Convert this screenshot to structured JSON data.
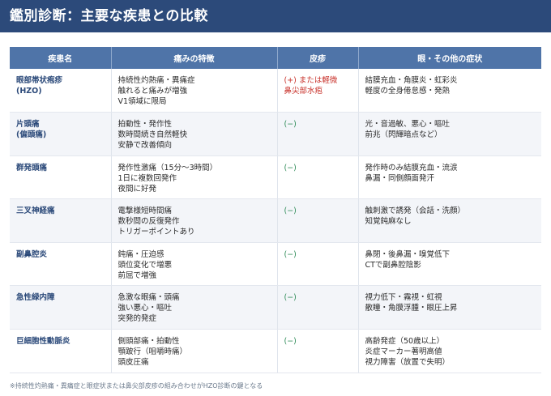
{
  "title": "鑑別診断：主要な疾患との比較",
  "columns": [
    "疾患名",
    "痛みの特徴",
    "皮疹",
    "眼・その他の症状"
  ],
  "rows": [
    {
      "disease": [
        "眼部帯状疱疹",
        "(HZO)"
      ],
      "pain": [
        "持続性灼熱痛・異痛症",
        "触れると痛みが増強",
        "V1領域に限局"
      ],
      "rash": [
        "(+) または軽微",
        "鼻尖部水疱"
      ],
      "rash_positive": true,
      "other": [
        "結膜充血・角膜炎・虹彩炎",
        "軽度の全身倦怠感・発熱"
      ]
    },
    {
      "disease": [
        "片頭痛",
        "(偏頭痛)"
      ],
      "pain": [
        "拍動性・発作性",
        "数時間続き自然軽快",
        "安静で改善傾向"
      ],
      "rash": [
        "(−)"
      ],
      "rash_positive": false,
      "other": [
        "光・音過敏、悪心・嘔吐",
        "前兆（閃輝暗点など）"
      ]
    },
    {
      "disease": [
        "群発頭痛"
      ],
      "pain": [
        "発作性激痛（15分〜3時間）",
        "1日に複数回発作",
        "夜間に好発"
      ],
      "rash": [
        "(−)"
      ],
      "rash_positive": false,
      "other": [
        "発作時のみ結膜充血・流涙",
        "鼻漏・同側顔面発汗"
      ]
    },
    {
      "disease": [
        "三叉神経痛"
      ],
      "pain": [
        "電撃様短時間痛",
        "数秒間の反復発作",
        "トリガーポイントあり"
      ],
      "rash": [
        "(−)"
      ],
      "rash_positive": false,
      "other": [
        "触刺激で誘発（会話・洗顔）",
        "知覚鈍麻なし"
      ]
    },
    {
      "disease": [
        "副鼻腔炎"
      ],
      "pain": [
        "鈍痛・圧迫感",
        "頭位変化で増悪",
        "前屈で増強"
      ],
      "rash": [
        "(−)"
      ],
      "rash_positive": false,
      "other": [
        "鼻閉・後鼻漏・嗅覚低下",
        "CTで副鼻腔陰影"
      ]
    },
    {
      "disease": [
        "急性緑内障"
      ],
      "pain": [
        "急激な眼痛・頭痛",
        "強い悪心・嘔吐",
        "突発的発症"
      ],
      "rash": [
        "(−)"
      ],
      "rash_positive": false,
      "other": [
        "視力低下・霧視・虹視",
        "散瞳・角膜浮腫・眼圧上昇"
      ]
    },
    {
      "disease": [
        "巨細胞性動脈炎"
      ],
      "pain": [
        "側頭部痛・拍動性",
        "顎跛行（咀嚼時痛）",
        "頭皮圧痛"
      ],
      "rash": [
        "(−)"
      ],
      "rash_positive": false,
      "other": [
        "高齢発症（50歳以上）",
        "炎症マーカー著明高値",
        "視力障害（放置で失明）"
      ]
    }
  ],
  "footnote": "※持続性灼熱痛・異痛症と眼症状または鼻尖部皮疹の組み合わせがHZO診断の鍵となる"
}
